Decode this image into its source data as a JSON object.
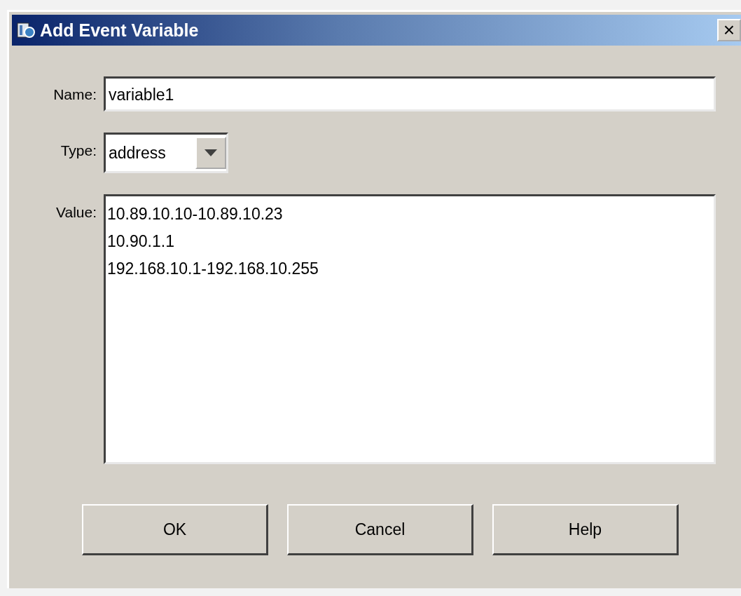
{
  "window": {
    "title": "Add Event Variable",
    "close": "×"
  },
  "fields": {
    "name": {
      "label": "Name:",
      "value": "variable1"
    },
    "type": {
      "label": "Type:",
      "value": "address"
    },
    "value": {
      "label": "Value:",
      "lines": [
        "10.89.10.10-10.89.10.23",
        "10.90.1.1",
        "192.168.10.1-192.168.10.255"
      ]
    }
  },
  "buttons": [
    "OK",
    "Cancel",
    "Help"
  ]
}
